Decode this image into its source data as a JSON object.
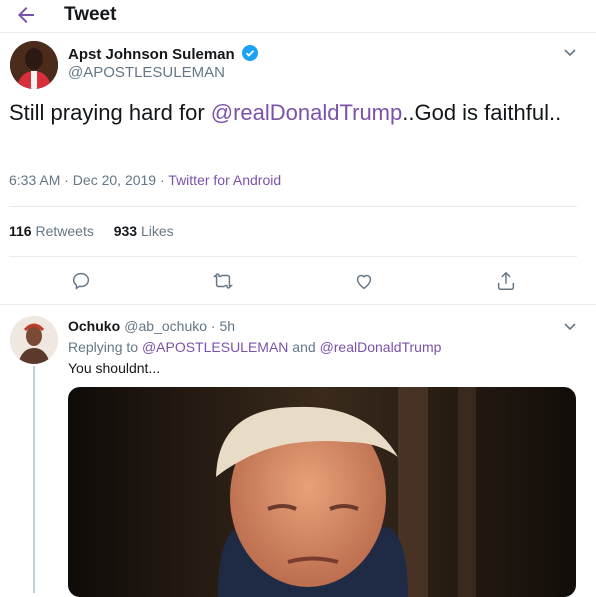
{
  "header": {
    "title": "Tweet",
    "back_icon": "arrow-left-icon",
    "accent": "#7b52ab"
  },
  "tweet": {
    "author_name": "Apst Johnson Suleman",
    "author_handle": "@APOSTLESULEMAN",
    "verified": true,
    "text_before": "Still praying hard for ",
    "mention": "@realDonaldTrump",
    "text_after": "..God is faithful..",
    "timestamp": "6:33 AM · Dec 20, 2019",
    "separator": " · ",
    "source": "Twitter for Android",
    "retweets_count": "116",
    "retweets_label": "Retweets",
    "likes_count": "933",
    "likes_label": "Likes"
  },
  "actions": [
    "reply-icon",
    "retweet-icon",
    "like-icon",
    "share-icon"
  ],
  "reply": {
    "author_name": "Ochuko",
    "author_handle": "@ab_ochuko",
    "time": " · 5h",
    "replying_prefix": "Replying to ",
    "replying_to_1": "@APOSTLESULEMAN",
    "replying_and": " and ",
    "replying_to_2": "@realDonaldTrump",
    "text": "You shouldnt..."
  }
}
